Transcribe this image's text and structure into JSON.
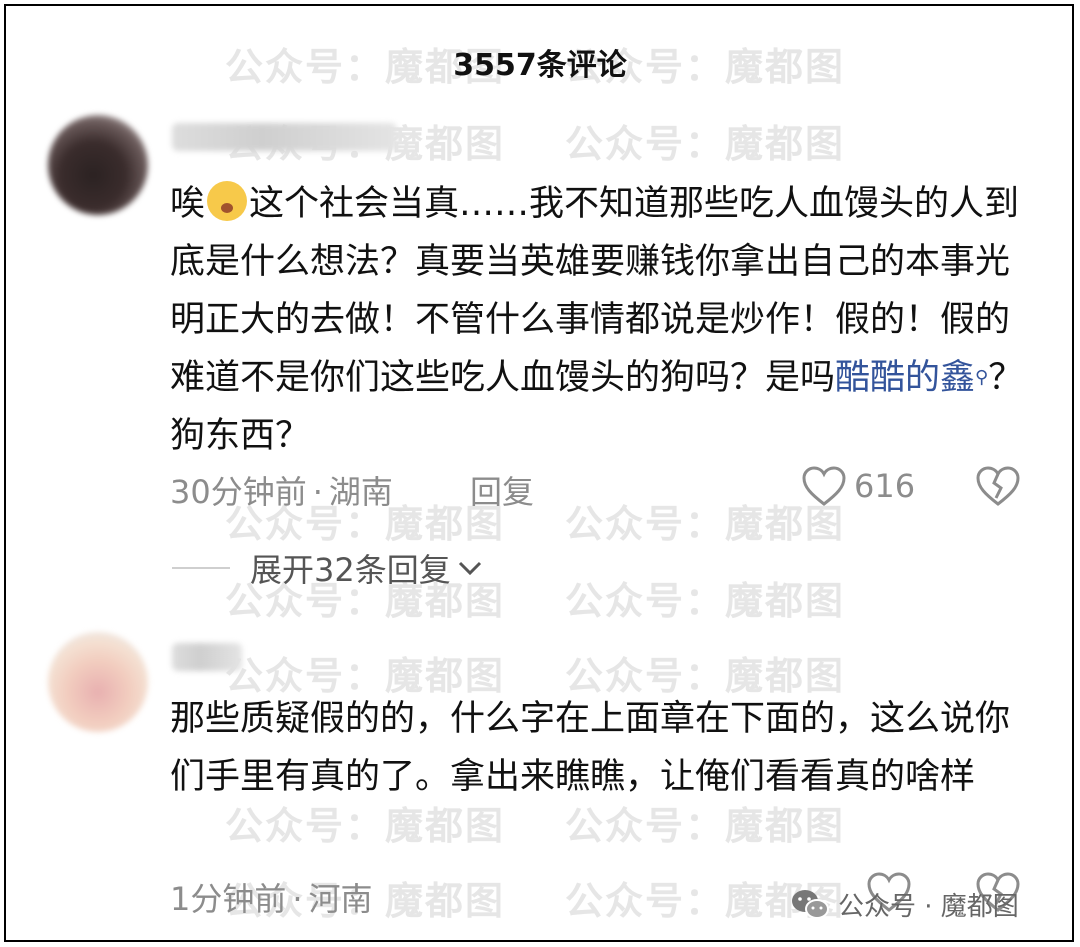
{
  "header": {
    "title": "3557条评论"
  },
  "watermark": {
    "text": "公众号：魔都图"
  },
  "comments": [
    {
      "text_prefix": "唉",
      "emoji": "face-exhaling-emoji",
      "text_main": "这个社会当真……我不知道那些吃人血馒头的人到底是什么想法？真要当英雄要赚钱你拿出自己的本事光明正大的去做！不管什么事情都说是炒作！假的！假的难道不是你们这些吃人血馒头的狗吗？是吗",
      "mention": "酷酷的鑫",
      "text_suffix": "？狗东西？",
      "time": "30分钟前",
      "location": "湖南",
      "reply_label": "回复",
      "likes": "616",
      "expand_label": "展开32条回复"
    },
    {
      "text": "那些质疑假的的，什么字在上面章在下面的，这么说你们手里有真的了。拿出来瞧瞧，让俺们看看真的啥样",
      "time": "1分钟前",
      "location": "河南"
    }
  ],
  "footer": {
    "label": "公众号 · 魔都图"
  },
  "colors": {
    "mention": "#33549b",
    "meta": "#8c8c8c",
    "watermark": "#e6e6e6"
  },
  "icons": [
    "heart-icon",
    "broken-heart-icon",
    "chevron-down-icon",
    "search-icon",
    "wechat-icon"
  ]
}
